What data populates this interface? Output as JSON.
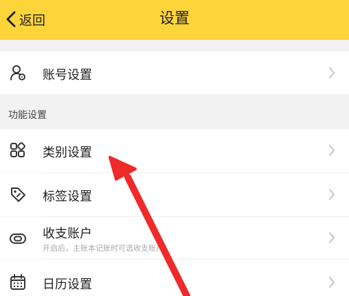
{
  "header": {
    "back_label": "返回",
    "title": "设置",
    "background": "#fdd53a"
  },
  "account_row": {
    "label": "账号设置",
    "icon": "user-settings-icon"
  },
  "section": {
    "title": "功能设置"
  },
  "rows": [
    {
      "label": "类别设置",
      "icon": "category-grid-icon"
    },
    {
      "label": "标签设置",
      "icon": "tag-icon"
    },
    {
      "label": "收支账户",
      "sublabel": "开启后，主账本记账时可选收支账户",
      "icon": "account-link-icon"
    },
    {
      "label": "日历设置",
      "icon": "calendar-icon"
    }
  ],
  "annotation": {
    "color": "#ee2a2a"
  }
}
